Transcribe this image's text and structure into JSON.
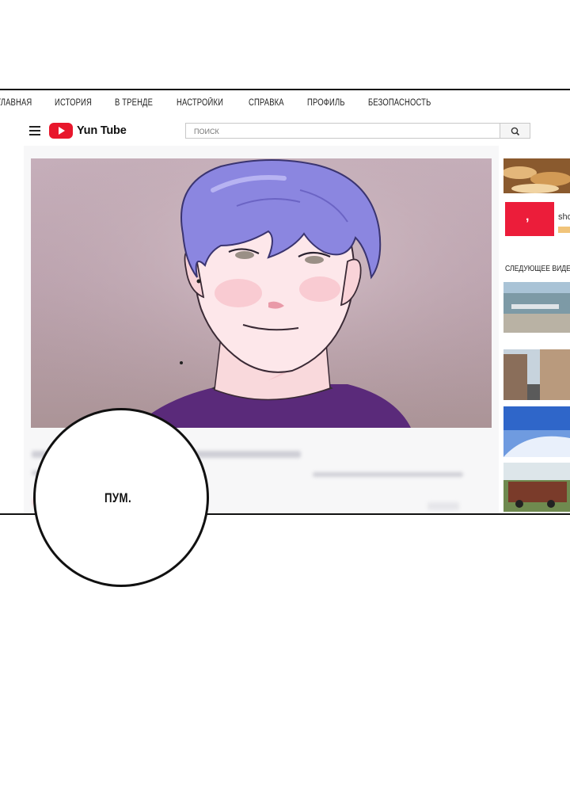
{
  "topnav": [
    "ГЛАВНАЯ",
    "ИСТОРИЯ",
    "В ТРЕНДЕ",
    "НАСТРОЙКИ",
    "СПРАВКА",
    "ПРОФИЛЬ",
    "БЕЗОПАСНОСТЬ"
  ],
  "header": {
    "app_name": "Yun Tube",
    "search_placeholder": "ПОИСК"
  },
  "sidebar": {
    "ad_snippet": "sho",
    "next_video_label": "СЛЕДУЮЩЕЕ ВИДЕО"
  },
  "bubble": {
    "text": "ПУМ."
  },
  "colors": {
    "brand_red": "#e8172c",
    "hair": "#8b86e0",
    "shirt": "#5a2a7a"
  }
}
